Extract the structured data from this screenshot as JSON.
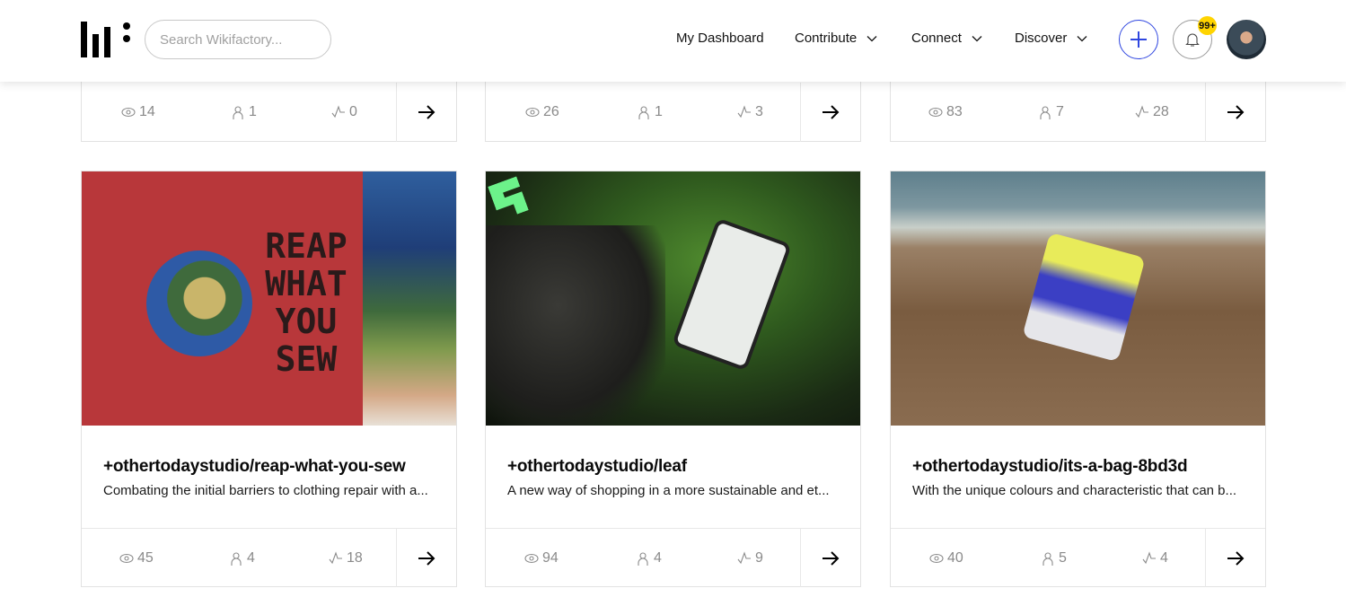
{
  "header": {
    "search_placeholder": "Search Wikifactory...",
    "nav": [
      {
        "label": "My Dashboard",
        "has_dropdown": false
      },
      {
        "label": "Contribute",
        "has_dropdown": true
      },
      {
        "label": "Connect",
        "has_dropdown": true
      },
      {
        "label": "Discover",
        "has_dropdown": true
      }
    ],
    "notifications_badge": "99+",
    "accent_color": "#2f46e0",
    "badge_color": "#ffd400"
  },
  "top_row_cards": [
    {
      "views": "14",
      "contributors": "1",
      "changes": "0"
    },
    {
      "views": "26",
      "contributors": "1",
      "changes": "3"
    },
    {
      "views": "83",
      "contributors": "7",
      "changes": "28"
    }
  ],
  "cards": [
    {
      "title": "+othertodaystudio/reap-what-you-sew",
      "description": "Combating the initial barriers to clothing repair with a...",
      "image_text": [
        "REAP",
        "WHAT",
        "YOU",
        "SEW"
      ],
      "views": "45",
      "contributors": "4",
      "changes": "18"
    },
    {
      "title": "+othertodaystudio/leaf",
      "description": "A new way of shopping in a more sustainable and et...",
      "views": "94",
      "contributors": "4",
      "changes": "9"
    },
    {
      "title": "+othertodaystudio/its-a-bag-8bd3d",
      "description": "With the unique colours and characteristic that can b...",
      "views": "40",
      "contributors": "5",
      "changes": "4"
    }
  ]
}
